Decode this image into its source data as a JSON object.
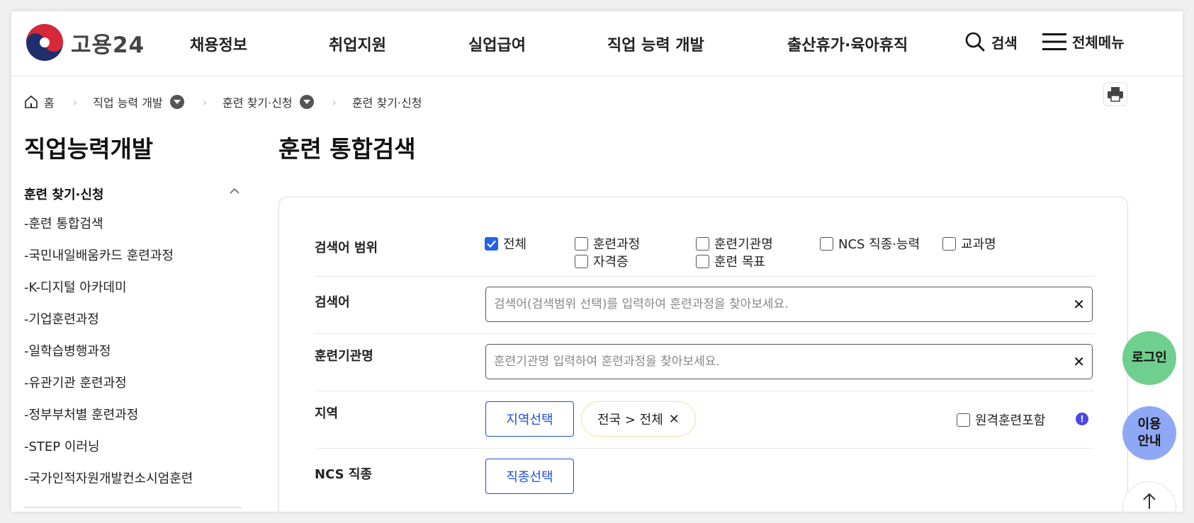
{
  "logo": {
    "text": "고용24"
  },
  "gnb": {
    "items": [
      "채용정보",
      "취업지원",
      "실업급여",
      "직업 능력 개발",
      "출산휴가·육아휴직"
    ],
    "search_label": "검색",
    "menu_label": "전체메뉴"
  },
  "breadcrumb": {
    "home": "홈",
    "level1": "직업 능력 개발",
    "level2": "훈련 찾기·신청",
    "level3": "훈련 찾기·신청"
  },
  "sidebar": {
    "title": "직업능력개발",
    "group": "훈련 찾기·신청",
    "items": [
      "-훈련 통합검색",
      "-국민내일배움카드 훈련과정",
      "-K-디지털 아카데미",
      "-기업훈련과정",
      "-일학습병행과정",
      "-유관기관 훈련과정",
      "-정부부처별 훈련과정",
      "-STEP 이러닝",
      "-국가인적자원개발컨소시엄훈련"
    ]
  },
  "main": {
    "title": "훈련 통합검색",
    "scope": {
      "label": "검색어 범위",
      "options": [
        {
          "label": "전체",
          "checked": true
        },
        {
          "label": "훈련과정",
          "checked": false
        },
        {
          "label": "훈련기관명",
          "checked": false
        },
        {
          "label": "NCS 직종·능력",
          "checked": false
        },
        {
          "label": "교과명",
          "checked": false
        },
        {
          "label": "자격증",
          "checked": false
        },
        {
          "label": "훈련 목표",
          "checked": false
        }
      ]
    },
    "keyword": {
      "label": "검색어",
      "placeholder": "검색어(검색범위 선택)를 입력하여 훈련과정을 찾아보세요.",
      "value": ""
    },
    "institution": {
      "label": "훈련기관명",
      "placeholder": "훈련기관명 입력하여 훈련과정을 찾아보세요.",
      "value": ""
    },
    "region": {
      "label": "지역",
      "button": "지역선택",
      "selected_tag": "전국 > 전체",
      "remote_label": "원격훈련포함",
      "remote_checked": false
    },
    "ncs": {
      "label": "NCS 직종",
      "button": "직종선택"
    }
  },
  "floating": {
    "login": "로그인",
    "guide_line1": "이용",
    "guide_line2": "안내"
  },
  "colors": {
    "accent_blue": "#1d4ed8",
    "checkbox_blue": "#2563eb",
    "login_green": "#6fcf8e",
    "guide_blue": "#8fa8f5",
    "tag_border": "#f0e2a0"
  }
}
